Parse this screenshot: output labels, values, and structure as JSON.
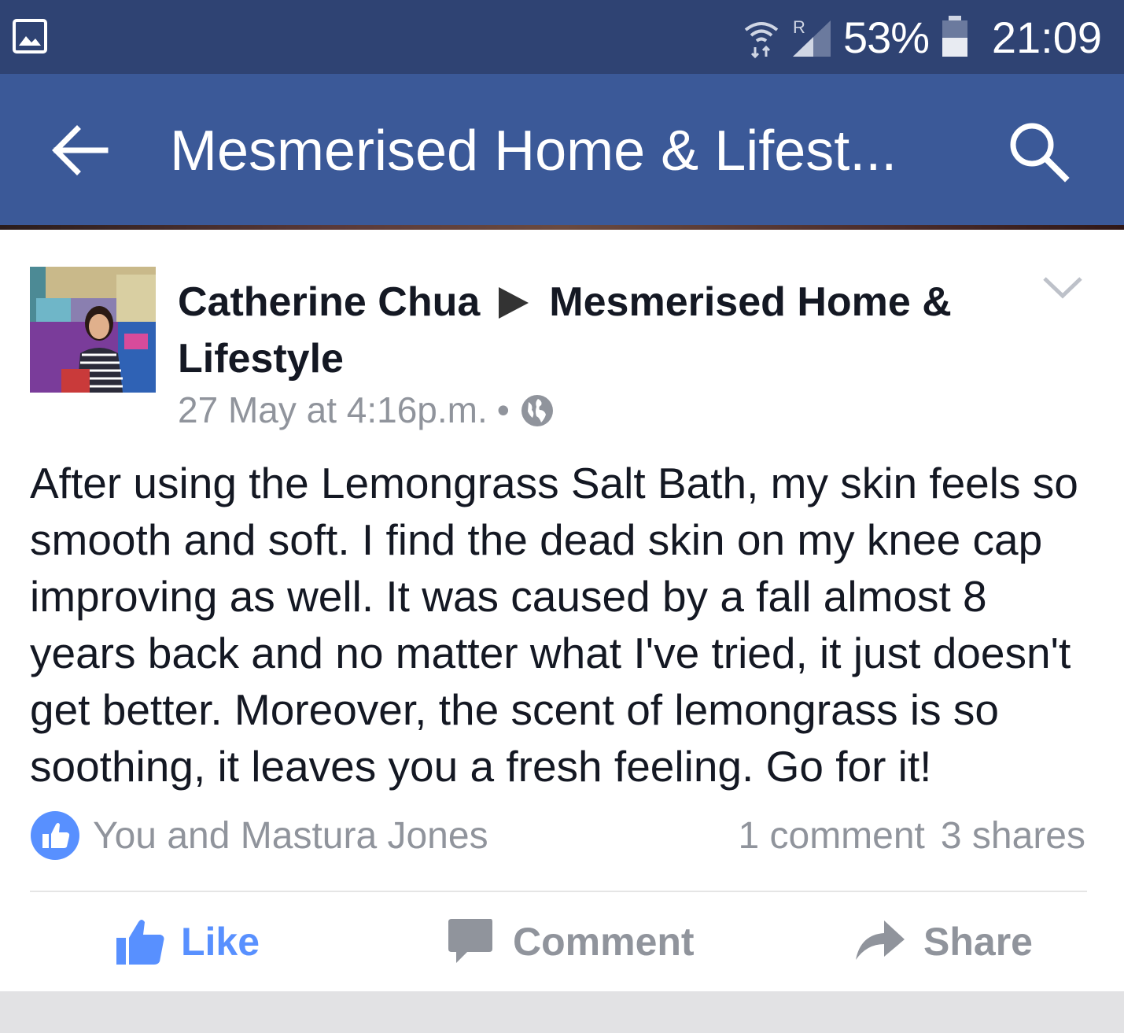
{
  "status_bar": {
    "battery_percent": "53%",
    "time": "21:09",
    "roaming_indicator": "R",
    "icons": [
      "gallery-notification-icon",
      "wifi-icon",
      "signal-icon",
      "battery-icon"
    ]
  },
  "app_bar": {
    "title": "Mesmerised Home & Lifest...",
    "icons": [
      "back-arrow-icon",
      "search-icon"
    ]
  },
  "post": {
    "author": "Catherine Chua",
    "target_page": "Mesmerised Home & Lifestyle",
    "timestamp": "27 May at 4:16p.m.",
    "separator": "•",
    "privacy_icon": "globe-icon",
    "menu_icon": "chevron-down-icon",
    "body": "After using the Lemongrass Salt Bath, my skin feels so smooth and soft. I find the dead skin on my knee cap improving as well. It was caused by a fall almost 8 years back and no matter what I've tried, it just doesn't get better. Moreover, the scent of lemongrass is so soothing, it leaves you a fresh feeling. Go for it!",
    "reactions": {
      "likers": "You and Mastura Jones",
      "comments": "1 comment",
      "shares": "3 shares"
    },
    "actions": {
      "like": "Like",
      "comment": "Comment",
      "share": "Share"
    }
  },
  "colors": {
    "status_bar": "#2f4373",
    "app_bar": "#3b5998",
    "like_active": "#5890ff",
    "muted_text": "#90949c",
    "primary_text": "#141823"
  }
}
